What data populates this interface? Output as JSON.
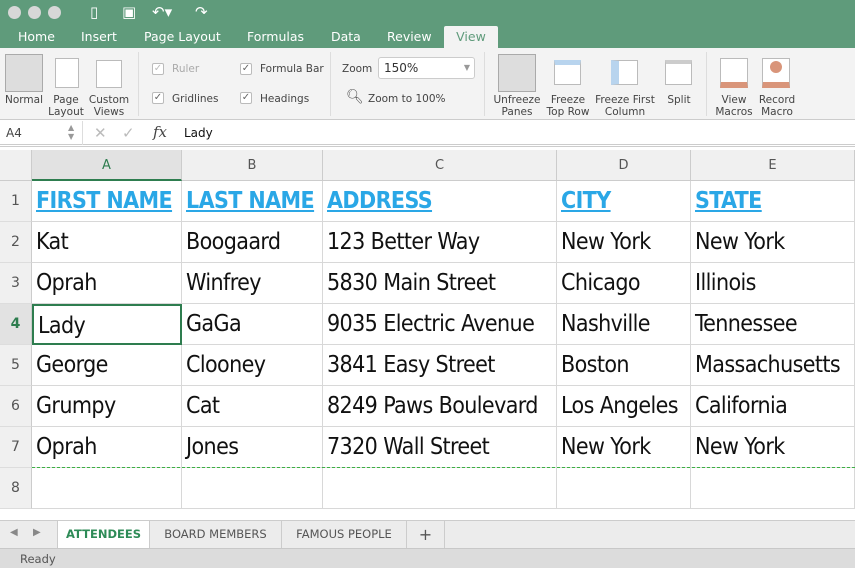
{
  "window": {
    "quick_access": [
      "sidebar-icon",
      "save-icon",
      "undo-icon",
      "redo-icon"
    ]
  },
  "ribbon_tabs": [
    "Home",
    "Insert",
    "Page Layout",
    "Formulas",
    "Data",
    "Review",
    "View"
  ],
  "active_tab": "View",
  "ribbon": {
    "views": [
      "Normal",
      "Page Layout",
      "Custom Views"
    ],
    "ruler": "Ruler",
    "formula_bar": "Formula Bar",
    "gridlines": "Gridlines",
    "headings": "Headings",
    "ruler_checked": true,
    "formula_bar_checked": true,
    "gridlines_checked": true,
    "headings_checked": true,
    "zoom_label": "Zoom",
    "zoom_value": "150%",
    "zoom_100": "Zoom to 100%",
    "window_buttons": [
      "Unfreeze Panes",
      "Freeze Top Row",
      "Freeze First Column",
      "Split"
    ],
    "macro_buttons": [
      "View Macros",
      "Record Macro"
    ]
  },
  "formula_bar": {
    "cell_ref": "A4",
    "fx": "fx",
    "value": "Lady"
  },
  "columns": [
    "A",
    "B",
    "C",
    "D",
    "E"
  ],
  "rows": [
    "1",
    "2",
    "3",
    "4",
    "5",
    "6",
    "7",
    "8"
  ],
  "header_row": [
    "FIRST NAME",
    "LAST NAME",
    "ADDRESS",
    "CITY",
    "STATE"
  ],
  "data_rows": [
    [
      "Kat",
      "Boogaard",
      "123 Better Way",
      "New York",
      "New York"
    ],
    [
      "Oprah",
      "Winfrey",
      "5830 Main Street",
      "Chicago",
      "Illinois"
    ],
    [
      "Lady",
      "GaGa",
      "9035 Electric Avenue",
      "Nashville",
      "Tennessee"
    ],
    [
      "George",
      "Clooney",
      "3841 Easy Street",
      "Boston",
      "Massachusetts"
    ],
    [
      "Grumpy",
      "Cat",
      "8249 Paws Boulevard",
      "Los Angeles",
      "California"
    ],
    [
      "Oprah",
      "Jones",
      "7320 Wall Street",
      "New York",
      "New York"
    ]
  ],
  "selected_cell": "A4",
  "sheet_tabs": [
    "ATTENDEES",
    "BOARD MEMBERS",
    "FAMOUS PEOPLE"
  ],
  "active_sheet": "ATTENDEES",
  "add_sheet": "+",
  "status": "Ready",
  "colors": {
    "title_bar": "#5f9b7b",
    "header_text": "#2aa7e6",
    "active_sheet": "#2e8b57",
    "page_break": "#3cb043"
  }
}
